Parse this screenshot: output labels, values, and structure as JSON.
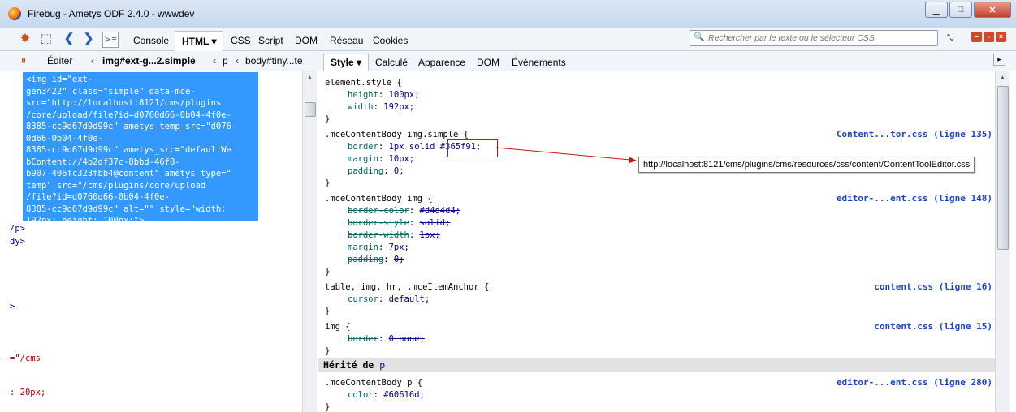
{
  "window": {
    "title": "Firebug - Ametys ODF 2.4.0 - wwwdev"
  },
  "toolbar": {
    "tabs": [
      "Console",
      "HTML ▾",
      "CSS",
      "Script",
      "DOM",
      "Réseau",
      "Cookies"
    ],
    "search_placeholder": "Rechercher par le texte ou le sélecteur CSS"
  },
  "subbar": {
    "edit_label": "Éditer",
    "breadcrumb": [
      "img#ext-g...2.simple",
      "p",
      "body#tiny...te"
    ],
    "side_tabs": [
      "Style ▾",
      "Calculé",
      "Apparence",
      "DOM",
      "Évènements"
    ]
  },
  "html_panel": {
    "selected_code": "<img id=\"ext-\ngen3422\" class=\"simple\" data-mce-\nsrc=\"http://localhost:8121/cms/plugins\n/core/upload/file?id=d0760d66-0b04-4f0e-\n8385-cc9d67d9d99c\" ametys_temp_src=\"d076\n0d66-0b04-4f0e-\n8385-cc9d67d9d99c\" ametys_src=\"defaultWe\nbContent://4b2df37c-8bbd-46f8-\nb907-406fc323fbb4@content\" ametys_type=\"\ntemp\" src=\"/cms/plugins/core/upload\n/file?id=d0760d66-0b04-4f0e-\n8385-cc9d67d9d99c\" alt=\"\" style=\"width:\n192px; height: 100px;\">",
    "lines": [
      "/p>",
      "dy>",
      ">",
      "=\"/cms",
      ": 20px;"
    ]
  },
  "style_panel": {
    "rules": [
      {
        "selector": "element.style {",
        "source": "",
        "props": [
          [
            "height",
            "100px;"
          ],
          [
            "width",
            "192px;"
          ]
        ],
        "struck": false
      },
      {
        "selector": ".mceContentBody img.simple {",
        "source": "Content...tor.css (ligne 135)",
        "props": [
          [
            "border",
            "1px solid #365f91;"
          ],
          [
            "margin",
            "10px;"
          ],
          [
            "padding",
            "0;"
          ]
        ],
        "struck": false
      },
      {
        "selector": ".mceContentBody img {",
        "source": "editor-...ent.css (ligne 148)",
        "props": [
          [
            "border-color",
            "#d4d4d4;"
          ],
          [
            "border-style",
            "solid;"
          ],
          [
            "border-width",
            "1px;"
          ],
          [
            "margin",
            "7px;"
          ],
          [
            "padding",
            "0;"
          ]
        ],
        "struck": true
      },
      {
        "selector": "table, img, hr, .mceItemAnchor {",
        "source": "content.css (ligne 16)",
        "props": [
          [
            "cursor",
            "default;"
          ]
        ],
        "struck": false
      },
      {
        "selector": "img {",
        "source": "content.css (ligne 15)",
        "props": [
          [
            "border",
            "0 none;"
          ]
        ],
        "struck": true
      }
    ],
    "inherited_label": "Hérité de",
    "inherited_tag": "p",
    "inherited_rule": {
      "selector": ".mceContentBody p {",
      "source": "editor-...ent.css (ligne 280)",
      "props": [
        [
          "color",
          "#60616d;"
        ]
      ]
    },
    "close_brace": "}",
    "highlight_value": "#365f91;"
  },
  "tooltip": "http://localhost:8121/cms/plugins/cms/resources/css/content/ContentToolEditor.css",
  "colors": {
    "selection": "#3399ff",
    "link": "#1a44c4",
    "highlight_box": "#cc1111"
  }
}
